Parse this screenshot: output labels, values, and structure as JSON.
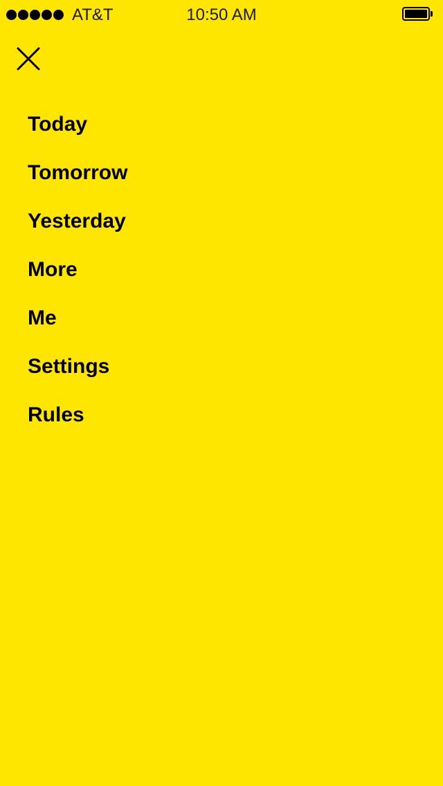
{
  "status_bar": {
    "carrier": "AT&T",
    "time": "10:50 AM",
    "signal_bars": 5,
    "battery_level": 1.0
  },
  "header": {
    "close_icon": "close-icon"
  },
  "menu": {
    "items": [
      {
        "label": "Today"
      },
      {
        "label": "Tomorrow"
      },
      {
        "label": "Yesterday"
      },
      {
        "label": "More"
      },
      {
        "label": "Me"
      },
      {
        "label": "Settings"
      },
      {
        "label": "Rules"
      }
    ]
  },
  "colors": {
    "background": "#FFE600",
    "text": "#000000"
  }
}
